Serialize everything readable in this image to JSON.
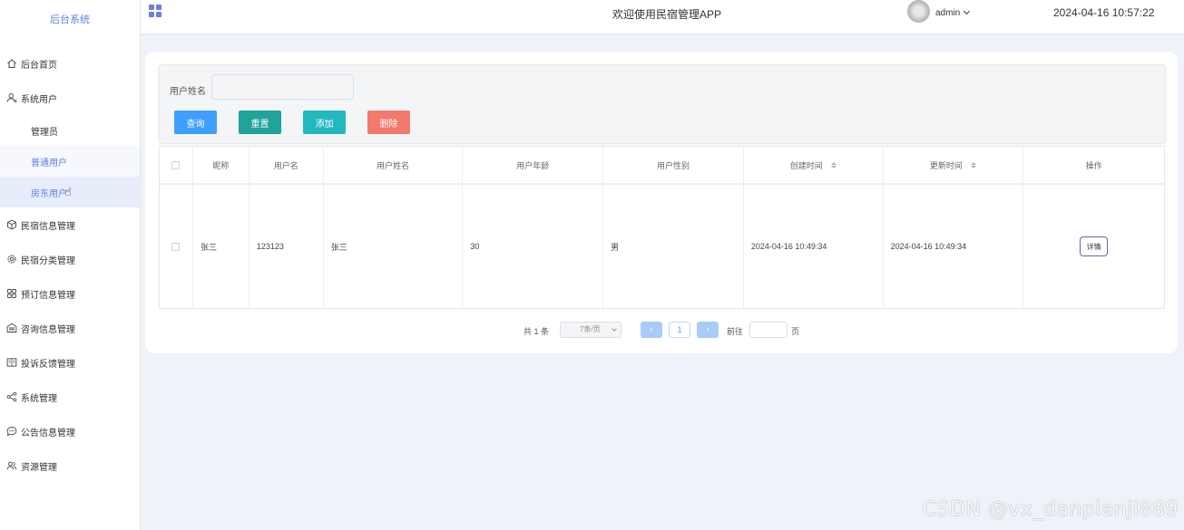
{
  "sidebar": {
    "title": "后台系统",
    "items": [
      {
        "label": "后台首页",
        "icon": "home-icon"
      },
      {
        "label": "系统用户",
        "icon": "user-icon"
      },
      {
        "label": "管理员"
      },
      {
        "label": "普通用户"
      },
      {
        "label": "房东用户"
      },
      {
        "label": "民宿信息管理",
        "icon": "cube-icon"
      },
      {
        "label": "民宿分类管理",
        "icon": "gear-icon"
      },
      {
        "label": "预订信息管理",
        "icon": "grid-icon"
      },
      {
        "label": "咨询信息管理",
        "icon": "message-box-icon"
      },
      {
        "label": "投诉反馈管理",
        "icon": "book-icon"
      },
      {
        "label": "系统管理",
        "icon": "share-icon"
      },
      {
        "label": "公告信息管理",
        "icon": "chat-icon"
      },
      {
        "label": "资源管理",
        "icon": "users-icon"
      }
    ]
  },
  "header": {
    "title": "欢迎使用民宿管理APP",
    "user": "admin",
    "datetime": "2024-04-16 10:57:22"
  },
  "search": {
    "label": "用户姓名",
    "placeholder": "",
    "buttons": {
      "query": "查询",
      "reset": "重置",
      "add": "添加",
      "delete": "删除"
    }
  },
  "table": {
    "columns": [
      "昵称",
      "用户名",
      "用户姓名",
      "用户年龄",
      "用户性别",
      "创建时间",
      "更新时间",
      "操作"
    ],
    "rows": [
      {
        "nickname": "张三",
        "username": "123123",
        "name": "张三",
        "age": "30",
        "gender": "男",
        "created": "2024-04-16 10:49:34",
        "updated": "2024-04-16 10:49:34",
        "action": "详情"
      }
    ]
  },
  "pagination": {
    "total": "共 1 条",
    "page_size": "7条/页",
    "current_page": "1",
    "goto_label": "前往",
    "goto_unit": "页",
    "prev": "‹",
    "next": "›"
  },
  "watermark": "CSDN @vx_danpianji889",
  "colors": {
    "primary": "#409eff",
    "reset": "#1fa39a",
    "add": "#22b8c0",
    "delete": "#f3796e",
    "sidebar_active_bg": "#e8edfb",
    "accent": "#5b7fe6"
  }
}
